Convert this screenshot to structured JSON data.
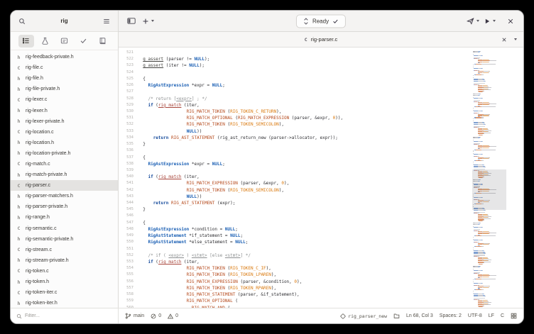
{
  "sidebar": {
    "title": "rig",
    "filter_placeholder": "Filter...",
    "selected_file": "rig-parser.c",
    "panel_icons": [
      "project-tree-icon",
      "tests-icon",
      "todo-icon",
      "checks-icon",
      "documentation-icon"
    ],
    "files": [
      {
        "type": "h",
        "name": "rig-feedback-private.h"
      },
      {
        "type": "C",
        "name": "rig-file.c"
      },
      {
        "type": "h",
        "name": "rig-file.h"
      },
      {
        "type": "h",
        "name": "rig-file-private.h"
      },
      {
        "type": "C",
        "name": "rig-lexer.c"
      },
      {
        "type": "h",
        "name": "rig-lexer.h"
      },
      {
        "type": "h",
        "name": "rig-lexer-private.h"
      },
      {
        "type": "C",
        "name": "rig-location.c"
      },
      {
        "type": "h",
        "name": "rig-location.h"
      },
      {
        "type": "h",
        "name": "rig-location-private.h"
      },
      {
        "type": "C",
        "name": "rig-match.c"
      },
      {
        "type": "h",
        "name": "rig-match-private.h"
      },
      {
        "type": "C",
        "name": "rig-parser.c"
      },
      {
        "type": "h",
        "name": "rig-parser-matchers.h"
      },
      {
        "type": "h",
        "name": "rig-parser-private.h"
      },
      {
        "type": "h",
        "name": "rig-range.h"
      },
      {
        "type": "C",
        "name": "rig-semantic.c"
      },
      {
        "type": "h",
        "name": "rig-semantic-private.h"
      },
      {
        "type": "C",
        "name": "rig-stream.c"
      },
      {
        "type": "h",
        "name": "rig-stream-private.h"
      },
      {
        "type": "C",
        "name": "rig-token.c"
      },
      {
        "type": "h",
        "name": "rig-token.h"
      },
      {
        "type": "C",
        "name": "rig-token-iter.c"
      },
      {
        "type": "h",
        "name": "rig-token-iter.h"
      }
    ]
  },
  "header": {
    "status": "Ready"
  },
  "tab": {
    "language": "C",
    "filename": "rig-parser.c"
  },
  "editor": {
    "first_line": 521,
    "lines": [
      {
        "ind": 0,
        "toks": []
      },
      {
        "ind": 2,
        "toks": [
          [
            "fu",
            "g_assert"
          ],
          [
            "p",
            " (parser != "
          ],
          [
            "nl",
            "NULL"
          ],
          [
            "p",
            ");"
          ]
        ]
      },
      {
        "ind": 2,
        "toks": [
          [
            "fu",
            "g_assert"
          ],
          [
            "p",
            " (iter != "
          ],
          [
            "nl",
            "NULL"
          ],
          [
            "p",
            ");"
          ]
        ]
      },
      {
        "ind": 0,
        "toks": []
      },
      {
        "ind": 2,
        "toks": [
          [
            "p",
            "{"
          ]
        ]
      },
      {
        "ind": 4,
        "toks": [
          [
            "ty",
            "RigAstExpression"
          ],
          [
            "p",
            " *expr = "
          ],
          [
            "nl",
            "NULL"
          ],
          [
            "p",
            ";"
          ]
        ]
      },
      {
        "ind": 0,
        "toks": []
      },
      {
        "ind": 4,
        "toks": [
          [
            "cm",
            "/* return ["
          ],
          [
            "cu",
            "<expr>"
          ],
          [
            "cm",
            "] ; */"
          ]
        ]
      },
      {
        "ind": 4,
        "toks": [
          [
            "kw",
            "if"
          ],
          [
            "p",
            " ("
          ],
          [
            "fm",
            "rig_match"
          ],
          [
            "p",
            " (iter,"
          ]
        ]
      },
      {
        "ind": 19,
        "toks": [
          [
            "mc",
            "RIG_MATCH_TOKEN"
          ],
          [
            "p",
            " ("
          ],
          [
            "ct",
            "RIG_TOKEN_C_RETURN"
          ],
          [
            "p",
            "),"
          ]
        ]
      },
      {
        "ind": 19,
        "toks": [
          [
            "mc",
            "RIG_MATCH_OPTIONAL"
          ],
          [
            "p",
            " ("
          ],
          [
            "mc",
            "RIG_MATCH_EXPRESSION"
          ],
          [
            "p",
            " (parser, &expr, "
          ],
          [
            "nu",
            "0"
          ],
          [
            "p",
            ")),"
          ]
        ]
      },
      {
        "ind": 19,
        "toks": [
          [
            "mc",
            "RIG_MATCH_TOKEN"
          ],
          [
            "p",
            " ("
          ],
          [
            "ct",
            "RIG_TOKEN_SEMICOLON"
          ],
          [
            "p",
            "),"
          ]
        ]
      },
      {
        "ind": 19,
        "toks": [
          [
            "nl",
            "NULL"
          ],
          [
            "p",
            "))"
          ]
        ]
      },
      {
        "ind": 6,
        "toks": [
          [
            "kw",
            "return"
          ],
          [
            "p",
            " "
          ],
          [
            "mc",
            "RIG_AST_STATEMENT"
          ],
          [
            "p",
            " (rig_ast_return_new (parser->allocator, expr));"
          ]
        ]
      },
      {
        "ind": 2,
        "toks": [
          [
            "p",
            "}"
          ]
        ]
      },
      {
        "ind": 0,
        "toks": []
      },
      {
        "ind": 2,
        "toks": [
          [
            "p",
            "{"
          ]
        ]
      },
      {
        "ind": 4,
        "toks": [
          [
            "ty",
            "RigAstExpression"
          ],
          [
            "p",
            " *expr = "
          ],
          [
            "nl",
            "NULL"
          ],
          [
            "p",
            ";"
          ]
        ]
      },
      {
        "ind": 0,
        "toks": []
      },
      {
        "ind": 4,
        "toks": [
          [
            "kw",
            "if"
          ],
          [
            "p",
            " ("
          ],
          [
            "fm",
            "rig_match"
          ],
          [
            "p",
            " (iter,"
          ]
        ]
      },
      {
        "ind": 19,
        "toks": [
          [
            "mc",
            "RIG_MATCH_EXPRESSION"
          ],
          [
            "p",
            " (parser, &expr, "
          ],
          [
            "nu",
            "0"
          ],
          [
            "p",
            "),"
          ]
        ]
      },
      {
        "ind": 19,
        "toks": [
          [
            "mc",
            "RIG_MATCH_TOKEN"
          ],
          [
            "p",
            " ("
          ],
          [
            "ct",
            "RIG_TOKEN_SEMICOLON"
          ],
          [
            "p",
            "),"
          ]
        ]
      },
      {
        "ind": 19,
        "toks": [
          [
            "nl",
            "NULL"
          ],
          [
            "p",
            "))"
          ]
        ]
      },
      {
        "ind": 6,
        "toks": [
          [
            "kw",
            "return"
          ],
          [
            "p",
            " "
          ],
          [
            "mc",
            "RIG_AST_STATEMENT"
          ],
          [
            "p",
            " (expr);"
          ]
        ]
      },
      {
        "ind": 2,
        "toks": [
          [
            "p",
            "}"
          ]
        ]
      },
      {
        "ind": 0,
        "toks": []
      },
      {
        "ind": 2,
        "toks": [
          [
            "p",
            "{"
          ]
        ]
      },
      {
        "ind": 4,
        "toks": [
          [
            "ty",
            "RigAstExpression"
          ],
          [
            "p",
            " *condition = "
          ],
          [
            "nl",
            "NULL"
          ],
          [
            "p",
            ";"
          ]
        ]
      },
      {
        "ind": 4,
        "toks": [
          [
            "ty",
            "RigAstStatement"
          ],
          [
            "p",
            " *if_statement = "
          ],
          [
            "nl",
            "NULL"
          ],
          [
            "p",
            ";"
          ]
        ]
      },
      {
        "ind": 4,
        "toks": [
          [
            "ty",
            "RigAstStatement"
          ],
          [
            "p",
            " *else_statement = "
          ],
          [
            "nl",
            "NULL"
          ],
          [
            "p",
            ";"
          ]
        ]
      },
      {
        "ind": 0,
        "toks": []
      },
      {
        "ind": 4,
        "toks": [
          [
            "cm",
            "/* if ( "
          ],
          [
            "cu",
            "<expr>"
          ],
          [
            "cm",
            " ) "
          ],
          [
            "cu",
            "<stmt>"
          ],
          [
            "cm",
            " [else "
          ],
          [
            "cu",
            "<stmt>"
          ],
          [
            "cm",
            "] */"
          ]
        ]
      },
      {
        "ind": 4,
        "toks": [
          [
            "kw",
            "if"
          ],
          [
            "p",
            " ("
          ],
          [
            "fm",
            "rig_match"
          ],
          [
            "p",
            " (iter,"
          ]
        ]
      },
      {
        "ind": 19,
        "toks": [
          [
            "mc",
            "RIG_MATCH_TOKEN"
          ],
          [
            "p",
            " ("
          ],
          [
            "ct",
            "RIG_TOKEN_C_IF"
          ],
          [
            "p",
            "),"
          ]
        ]
      },
      {
        "ind": 19,
        "toks": [
          [
            "mc",
            "RIG_MATCH_TOKEN"
          ],
          [
            "p",
            " ("
          ],
          [
            "ct",
            "RIG_TOKEN_LPAREN"
          ],
          [
            "p",
            "),"
          ]
        ]
      },
      {
        "ind": 19,
        "toks": [
          [
            "mc",
            "RIG_MATCH_EXPRESSION"
          ],
          [
            "p",
            " (parser, &condition, "
          ],
          [
            "nu",
            "0"
          ],
          [
            "p",
            "),"
          ]
        ]
      },
      {
        "ind": 19,
        "toks": [
          [
            "mc",
            "RIG_MATCH_TOKEN"
          ],
          [
            "p",
            " ("
          ],
          [
            "ct",
            "RIG_TOKEN_RPAREN"
          ],
          [
            "p",
            "),"
          ]
        ]
      },
      {
        "ind": 19,
        "toks": [
          [
            "mc",
            "RIG_MATCH_STATEMENT"
          ],
          [
            "p",
            " (parser, &if_statement),"
          ]
        ]
      },
      {
        "ind": 19,
        "toks": [
          [
            "mc",
            "RIG_MATCH_OPTIONAL"
          ],
          [
            "p",
            " ("
          ]
        ]
      },
      {
        "ind": 21,
        "toks": [
          [
            "mc",
            "RIG_MATCH_AND"
          ],
          [
            "p",
            " ("
          ]
        ]
      }
    ]
  },
  "minimap": {
    "repeat": 6
  },
  "statusbar": {
    "branch": "main",
    "errors": "0",
    "warnings": "0",
    "symbol": "rig_parser_new",
    "position": "Ln 68, Col 3",
    "indentation": "Spaces: 2",
    "encoding": "UTF-8",
    "line_ending": "LF",
    "language": "C"
  },
  "colors": {
    "accent": "#3584e4",
    "keyword": "#1b4f9e",
    "type": "#1a5fb4",
    "macro": "#b5491b",
    "constant": "#d9770a",
    "comment": "#8d9091",
    "selection_bg": "#e4e3e1",
    "headerbar_bg": "#f4f3f2"
  }
}
